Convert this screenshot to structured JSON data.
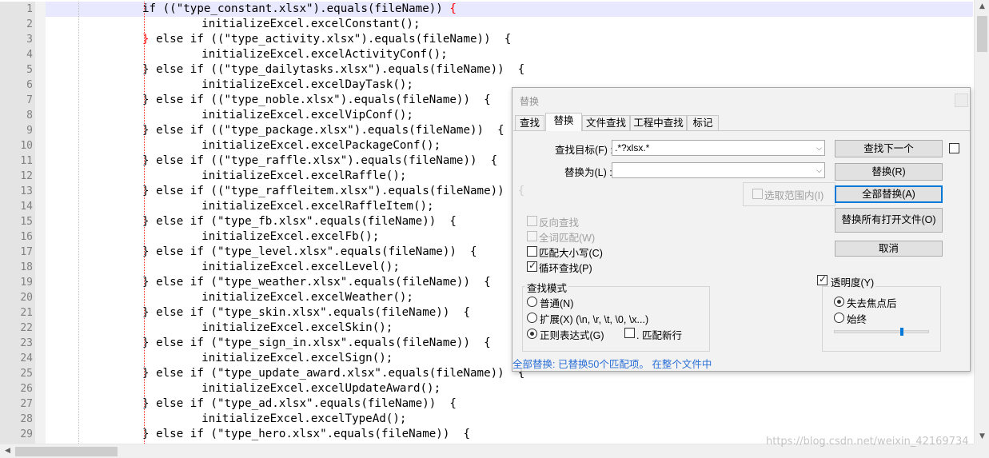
{
  "editor": {
    "line_numbers": [
      "1",
      "2",
      "3",
      "4",
      "5",
      "6",
      "7",
      "8",
      "9",
      "10",
      "11",
      "12",
      "13",
      "14",
      "15",
      "16",
      "17",
      "18",
      "19",
      "20",
      "21",
      "22",
      "23",
      "24",
      "25",
      "26",
      "27",
      "28",
      "29"
    ],
    "lines": [
      "if ((\"type_constant.xlsx\").equals(fileName)) ",
      "    initializeExcel.excelConstant();",
      "} else if ((\"type_activity.xlsx\").equals(fileName))  {",
      "    initializeExcel.excelActivityConf();",
      "} else if ((\"type_dailytasks.xlsx\").equals(fileName))  {",
      "    initializeExcel.excelDayTask();",
      "} else if ((\"type_noble.xlsx\").equals(fileName))  {",
      "    initializeExcel.excelVipConf();",
      "} else if ((\"type_package.xlsx\").equals(fileName))  {",
      "    initializeExcel.excelPackageConf();",
      "} else if ((\"type_raffle.xlsx\").equals(fileName))  {",
      "    initializeExcel.excelRaffle();",
      "} else if ((\"type_raffleitem.xlsx\").equals(fileName))  {",
      "    initializeExcel.excelRaffleItem();",
      "} else if (\"type_fb.xlsx\".equals(fileName))  {",
      "    initializeExcel.excelFb();",
      "} else if (\"type_level.xlsx\".equals(fileName))  {",
      "    initializeExcel.excelLevel();",
      "} else if (\"type_weather.xlsx\".equals(fileName))  {",
      "    initializeExcel.excelWeather();",
      "} else if (\"type_skin.xlsx\".equals(fileName))  {",
      "    initializeExcel.excelSkin();",
      "} else if (\"type_sign_in.xlsx\".equals(fileName))  {",
      "    initializeExcel.excelSign();",
      "} else if (\"type_update_award.xlsx\".equals(fileName))  {",
      "    initializeExcel.excelUpdateAward();",
      "} else if (\"type_ad.xlsx\".equals(fileName))  {",
      "    initializeExcel.excelTypeAd();",
      "} else if (\"type_hero.xlsx\".equals(fileName))  {"
    ],
    "first_line_brace": "{",
    "third_line_brace": "}"
  },
  "watermark": "https://blog.csdn.net/weixin_42169734",
  "dialog": {
    "title": "替换",
    "tabs": [
      "查找",
      "替换",
      "文件查找",
      "工程中查找",
      "标记"
    ],
    "active_tab": "替换",
    "find_label": "查找目标(F) :",
    "find_value": ".*?xlsx.*",
    "replace_label": "替换为(L) :",
    "replace_value": "",
    "in_selection_label": "选取范围内(I)",
    "buttons": {
      "find_next": "查找下一个",
      "replace": "替换(R)",
      "replace_all": "全部替换(A)",
      "replace_all_open": "替换所有打开文件(O)",
      "cancel": "取消"
    },
    "options": {
      "backward": "反向查找",
      "whole_word": "全词匹配(W)",
      "match_case": "匹配大小写(C)",
      "wrap_around": "循环查找(P)"
    },
    "search_mode": {
      "title": "查找模式",
      "normal": "普通(N)",
      "extended": "扩展(X) (\\n, \\r, \\t, \\0, \\x...)",
      "regex": "正则表达式(G)",
      "dot_newline": ". 匹配新行",
      "selected": "regex"
    },
    "transparency": {
      "title": "透明度(Y)",
      "on_lose_focus": "失去焦点后",
      "always": "始终",
      "selected": "on_lose_focus",
      "level_fraction": 0.7
    },
    "status": "全部替换: 已替换50个匹配项。 在整个文件中"
  },
  "colors": {
    "accent": "#0078d7",
    "status_text": "#2a6fd6",
    "current_line": "#e8e8ff",
    "brace_highlight": "#ff0000"
  }
}
